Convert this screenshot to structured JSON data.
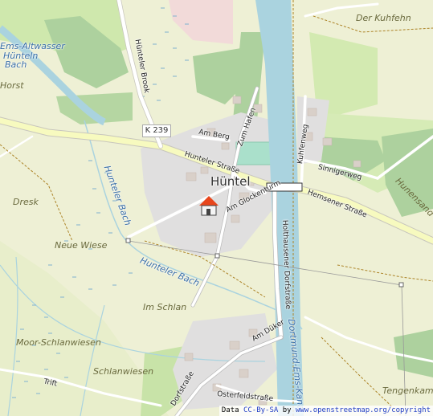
{
  "colors": {
    "background": "#f2efe9",
    "farmland": "#eef0d5",
    "meadow": "#d0e9ad",
    "forest": "#add19e",
    "residential": "#e0dfdf",
    "water": "#aad3df",
    "building": "#d9d0c9",
    "road": "#ffffff",
    "secondary_road": "#f7fabf",
    "marker": "#e8461c"
  },
  "place": {
    "village": "Hüntel"
  },
  "roads": {
    "ref": "K 239",
    "labels": {
      "hunteler_strasse": "Hunteler Straße",
      "am_glockenturm": "Am Glockenturm",
      "am_berg": "Am Berg",
      "zum_hafen": "Zum Hafen",
      "hunteler_brook": "Hünteler Brook",
      "kuhfenweg": "Kuhfenweg",
      "sinnigerweg": "Sinnigerweg",
      "hemsener_strasse": "Hemsener Straße",
      "holthausener_dorfstrasse": "Holthausener Dorfstraße",
      "am_duker": "Am Düker",
      "trift": "Trift",
      "dorfstrasse": "Dorfstraße",
      "osterfeldstrasse": "Osterfeldstraße"
    }
  },
  "water": {
    "altwasser": "Ems-Altwasser",
    "hunteln": "Hünteln",
    "bach": "Bach",
    "hunteler_bach_1": "Hunteler Bach",
    "hunteler_bach_2": "Hunteler Bach",
    "kanal": "Dortmund-Ems-Kanal"
  },
  "fields": {
    "horst": "Horst",
    "dresk": "Dresk",
    "neue_wiese": "Neue Wiese",
    "im_schlan": "Im Schlan",
    "moor_schlanwiesen": "Moor-Schlanwiesen",
    "schlanwiesen": "Schlanwiesen",
    "der_kuhfehn": "Der Kuhfehn",
    "hunensand": "Hunensand",
    "tengenkamp": "Tengenkamp"
  },
  "attribution": {
    "prefix": "Data ",
    "license": "CC-By-SA",
    "by": " by ",
    "site": "www.openstreetmap.org/copyright"
  }
}
